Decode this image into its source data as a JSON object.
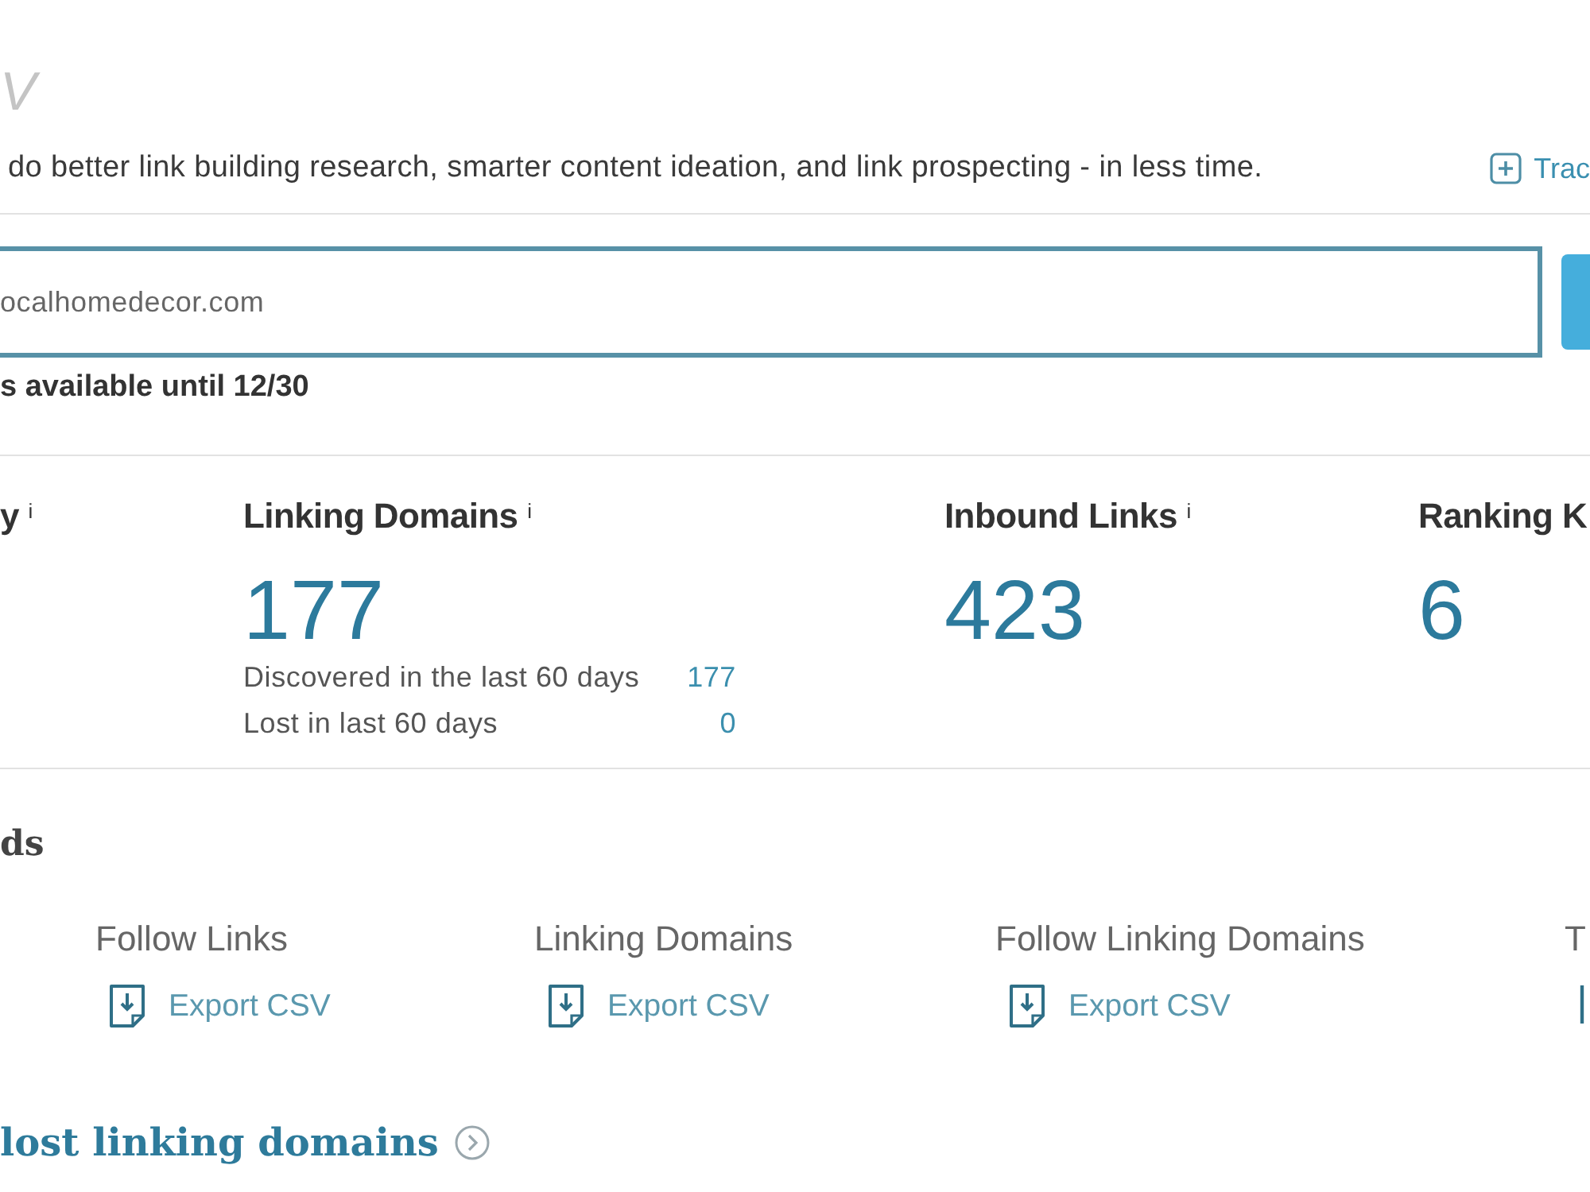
{
  "header": {
    "title": "V",
    "description": "do better link building research, smarter content ideation, and link prospecting - in less time.",
    "track_link": "Trac"
  },
  "search": {
    "value": "ocalhomedecor.com",
    "note": "s available until 12/30"
  },
  "metrics": [
    {
      "label": "y $^{i}$"
    },
    {
      "label": "Linking Domains $^{i}$",
      "value": "177",
      "details": [
        {
          "label": "Discovered in the last 60 days",
          "value": "177"
        },
        {
          "label": "Lost in last 60 days",
          "value": "0"
        }
      ]
    },
    {
      "label": "Inbound Links $^{i}$",
      "value": "423"
    },
    {
      "label": "Ranking K",
      "value": "6"
    }
  ],
  "exports": {
    "title": "ds",
    "columns": [
      {
        "label": "Follow Links",
        "action": "Export CSV"
      },
      {
        "label": "Linking Domains",
        "action": "Export CSV"
      },
      {
        "label": "Follow Linking Domains",
        "action": "Export CSV"
      },
      {
        "label": "T"
      }
    ]
  },
  "lost_link": "lost linking domains"
}
